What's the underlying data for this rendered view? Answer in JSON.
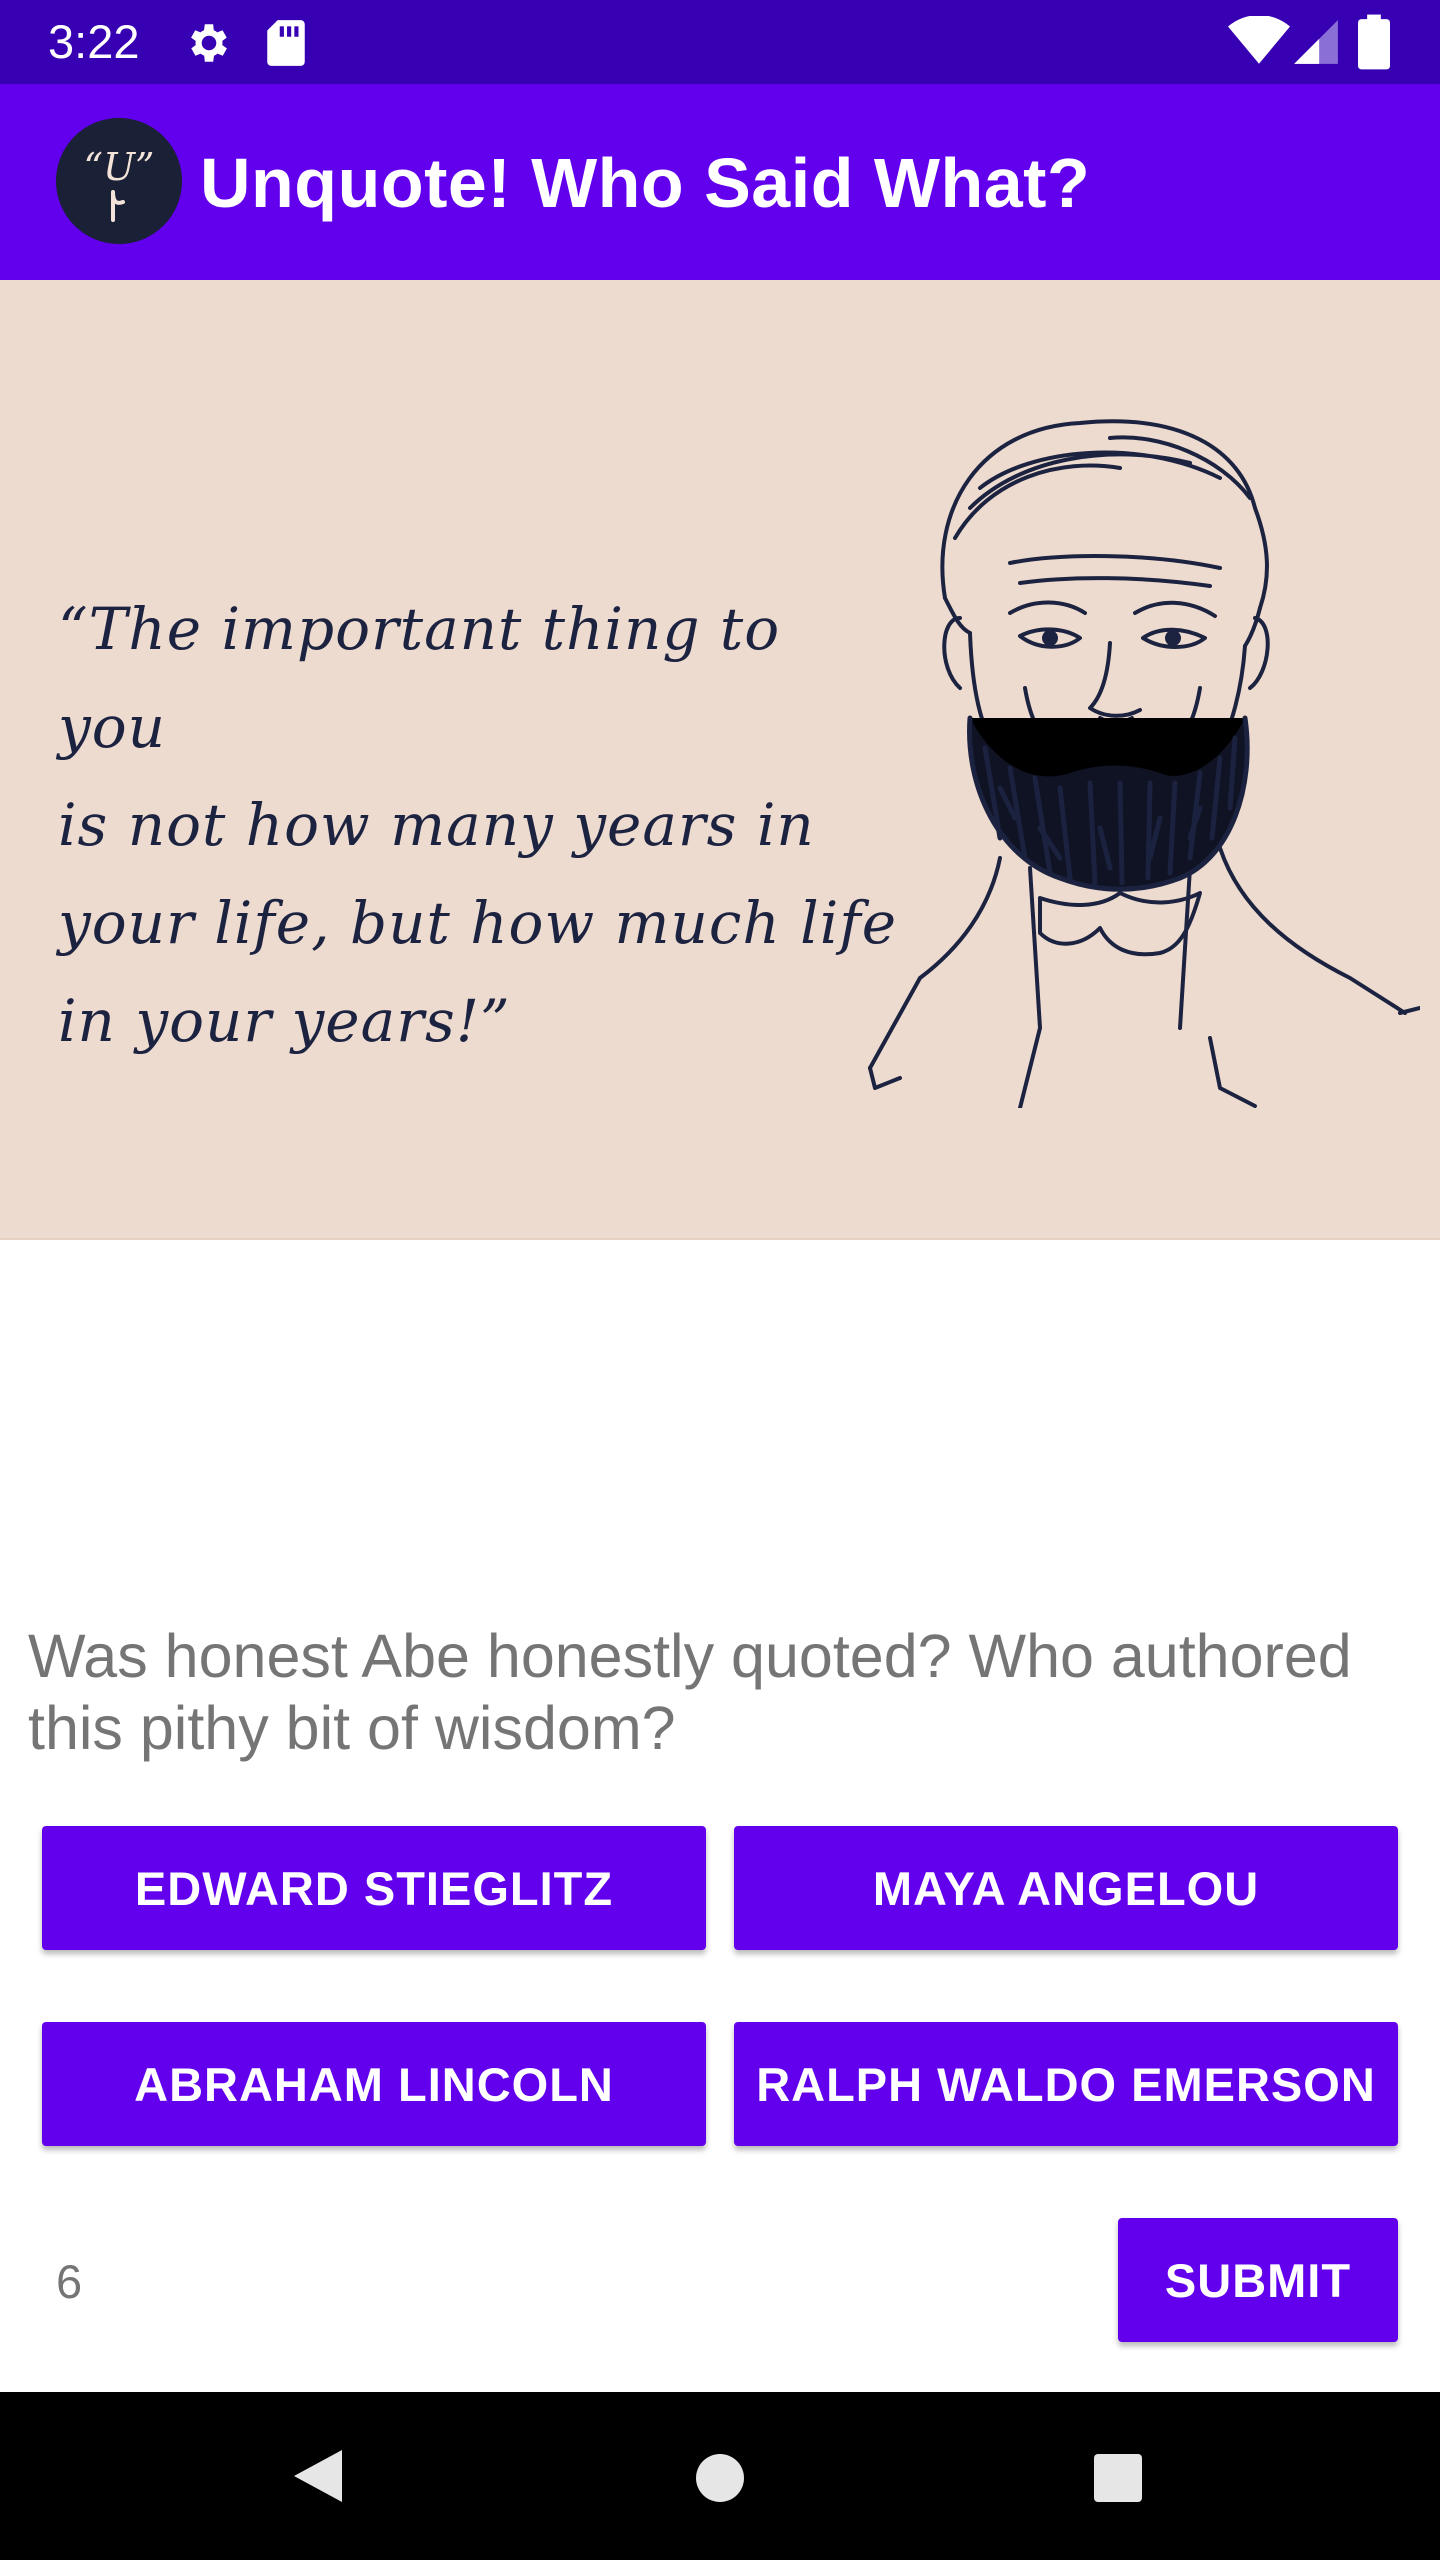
{
  "status_bar": {
    "time": "3:22",
    "icons": [
      "settings-gear",
      "sd-card",
      "wifi",
      "cell-signal",
      "battery"
    ]
  },
  "app_bar": {
    "logo_text": "“U”",
    "title": "Unquote! Who Said What?"
  },
  "quote": {
    "text": "“The important thing to you is not how many years in your life, but how much life in your years!”",
    "lines": [
      "“The important thing to you",
      "is not how many years in",
      "your life, but how much life",
      "in your years!”"
    ]
  },
  "question": "Was honest Abe honestly quoted? Who authored this pithy bit of wisdom?",
  "answers": [
    "Edward Stieglitz",
    "Maya Angelou",
    "Abraham Lincoln",
    "Ralph Waldo Emerson"
  ],
  "counter": "6",
  "submit_label": "Submit",
  "colors": {
    "status_bar": "#3700B3",
    "primary": "#6200EE",
    "quote_bg": "#EEDBCF",
    "ink": "#1C2340",
    "question_text": "#757575"
  }
}
